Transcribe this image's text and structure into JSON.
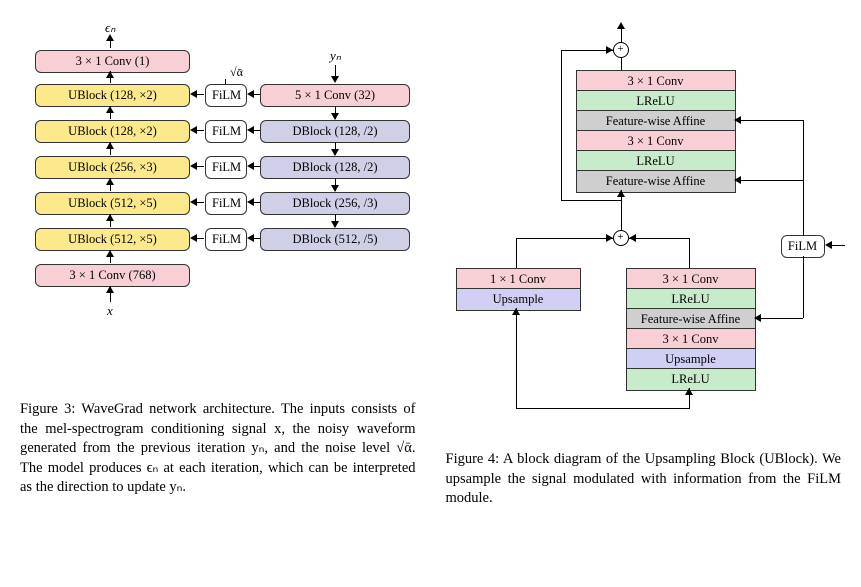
{
  "fig3": {
    "inputs": {
      "x": "x",
      "yn": "yₙ",
      "sqrt_alpha": "√ᾱ",
      "eps": "ϵₙ"
    },
    "left_blocks": [
      "3 × 1 Conv (1)",
      "UBlock (128, ×2)",
      "UBlock (128, ×2)",
      "UBlock (256, ×3)",
      "UBlock (512, ×5)",
      "UBlock (512, ×5)",
      "3 × 1 Conv (768)"
    ],
    "film": "FiLM",
    "right_blocks": [
      "5 × 1 Conv (32)",
      "DBlock (128, /2)",
      "DBlock (128, /2)",
      "DBlock (256, /3)",
      "DBlock (512, /5)"
    ],
    "caption": "Figure 3: WaveGrad network architecture. The inputs consists of the mel-spectrogram conditioning signal x, the noisy waveform generated from the previous iteration yₙ, and the noise level √ᾱ. The model produces ϵₙ at each iteration, which can be interpreted as the direction to update yₙ."
  },
  "fig4": {
    "top_stack": [
      {
        "text": "3 × 1 Conv",
        "cls": "pink"
      },
      {
        "text": "LReLU",
        "cls": "green"
      },
      {
        "text": "Feature-wise Affine",
        "cls": "grey"
      },
      {
        "text": "3 × 1 Conv",
        "cls": "pink"
      },
      {
        "text": "LReLU",
        "cls": "green"
      },
      {
        "text": "Feature-wise Affine",
        "cls": "grey"
      }
    ],
    "left_stack": [
      {
        "text": "1 × 1 Conv",
        "cls": "pink"
      },
      {
        "text": "Upsample",
        "cls": "blue"
      }
    ],
    "right_stack": [
      {
        "text": "3 × 1 Conv",
        "cls": "pink"
      },
      {
        "text": "LReLU",
        "cls": "green"
      },
      {
        "text": "Feature-wise Affine",
        "cls": "grey"
      },
      {
        "text": "3 × 1 Conv",
        "cls": "pink"
      },
      {
        "text": "Upsample",
        "cls": "blue"
      },
      {
        "text": "LReLU",
        "cls": "green"
      }
    ],
    "adder": "+",
    "film_label": "FiLM",
    "caption": "Figure 4: A block diagram of the Upsampling Block (UBlock). We upsample the signal modulated with information from the FiLM module."
  }
}
